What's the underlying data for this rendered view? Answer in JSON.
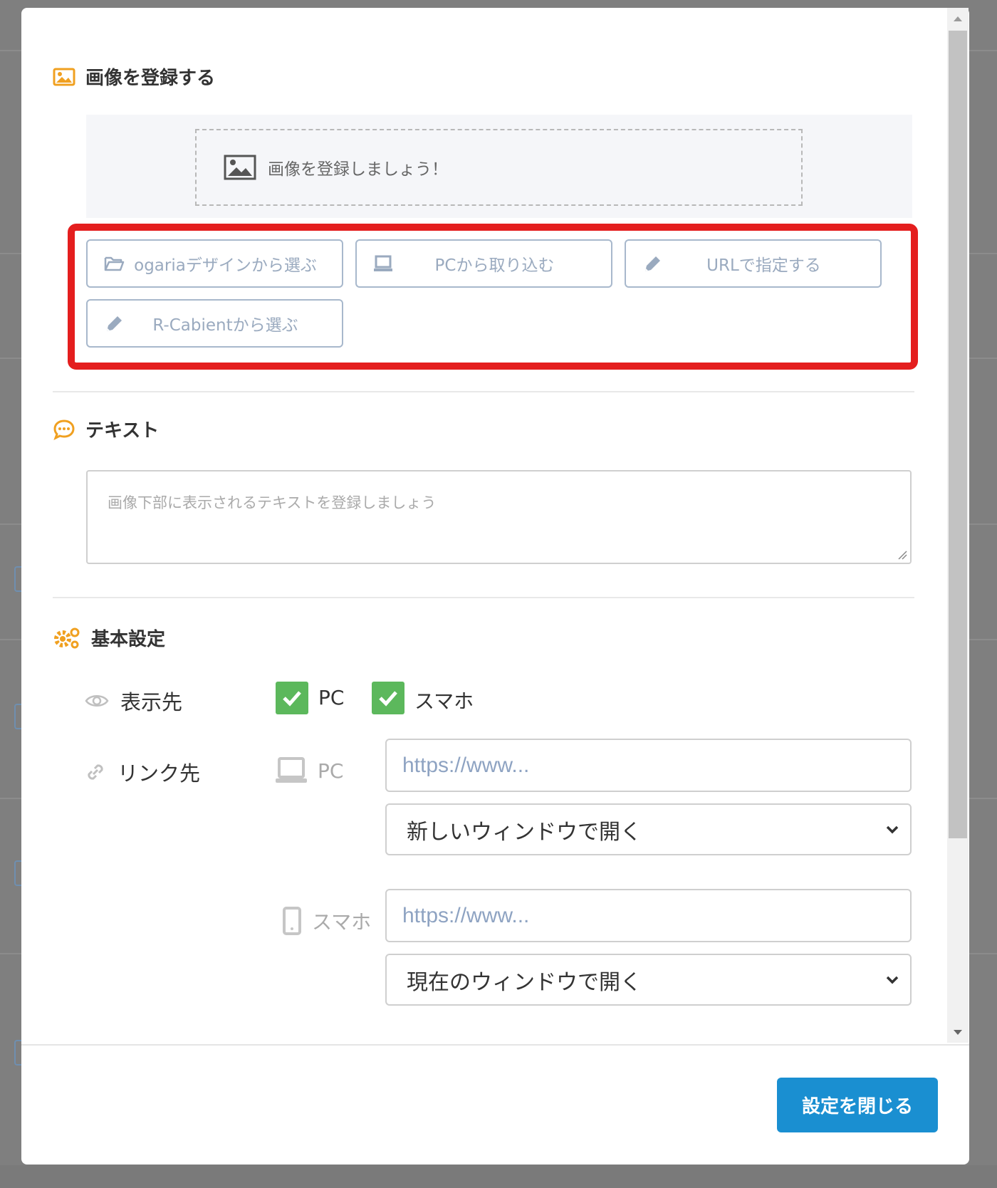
{
  "image_section": {
    "title": "画像を登録する",
    "dropzone_text": "画像を登録しましょう！",
    "buttons": [
      {
        "label": "ogariaデザインから選ぶ",
        "icon": "folder-open-icon"
      },
      {
        "label": "PCから取り込む",
        "icon": "laptop-icon"
      },
      {
        "label": "URLで指定する",
        "icon": "pencil-icon"
      },
      {
        "label": "R-Cabientから選ぶ",
        "icon": "pencil-icon"
      }
    ]
  },
  "text_section": {
    "title": "テキスト",
    "placeholder": "画像下部に表示されるテキストを登録しましょう"
  },
  "basic_settings": {
    "title": "基本設定",
    "display_label": "表示先",
    "display_pc": "PC",
    "display_sp": "スマホ",
    "link_label": "リンク先",
    "pc_label": "PC",
    "pc_url_placeholder": "https://www...",
    "pc_window": "新しいウィンドウで開く",
    "sp_label": "スマホ",
    "sp_url_placeholder": "https://www...",
    "sp_window": "現在のウィンドウで開く"
  },
  "footer": {
    "close_label": "設定を閉じる"
  },
  "colors": {
    "accent_orange": "#f0a020",
    "check_green": "#5cb85c",
    "primary_blue": "#1a8fd1",
    "highlight_red": "#e41e1e"
  }
}
